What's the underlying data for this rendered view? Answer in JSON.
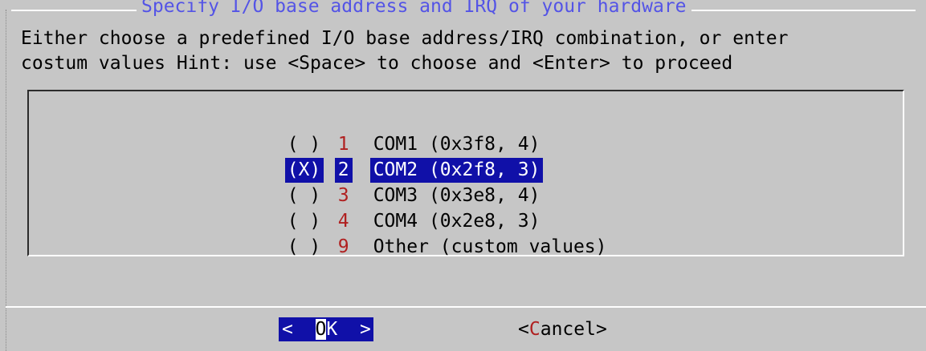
{
  "dialog": {
    "title": "Specify I/O base address and IRQ of your hardware",
    "prompt_line1": "Either choose a predefined I/O base address/IRQ combination, or enter",
    "prompt_line2": "costum values Hint: use <Space> to choose and <Enter> to proceed"
  },
  "options": [
    {
      "radio": "( )",
      "tag": "1",
      "label": "COM1 (0x3f8, 4)",
      "selected": false
    },
    {
      "radio": "(X)",
      "tag": "2",
      "label": "COM2 (0x2f8, 3)",
      "selected": true
    },
    {
      "radio": "( )",
      "tag": "3",
      "label": "COM3 (0x3e8, 4)",
      "selected": false
    },
    {
      "radio": "( )",
      "tag": "4",
      "label": "COM4 (0x2e8, 3)",
      "selected": false
    },
    {
      "radio": "( )",
      "tag": "9",
      "label": "Other (custom values)",
      "selected": false
    }
  ],
  "buttons": {
    "ok": {
      "left": "<  ",
      "hot": "O",
      "rest": "K  >"
    },
    "cancel": {
      "left": "<",
      "hot": "C",
      "rest": "ancel>"
    }
  },
  "colors": {
    "background": "#c6c6c6",
    "title": "#5454e6",
    "selection": "#1010a8",
    "tag": "#b02020"
  }
}
